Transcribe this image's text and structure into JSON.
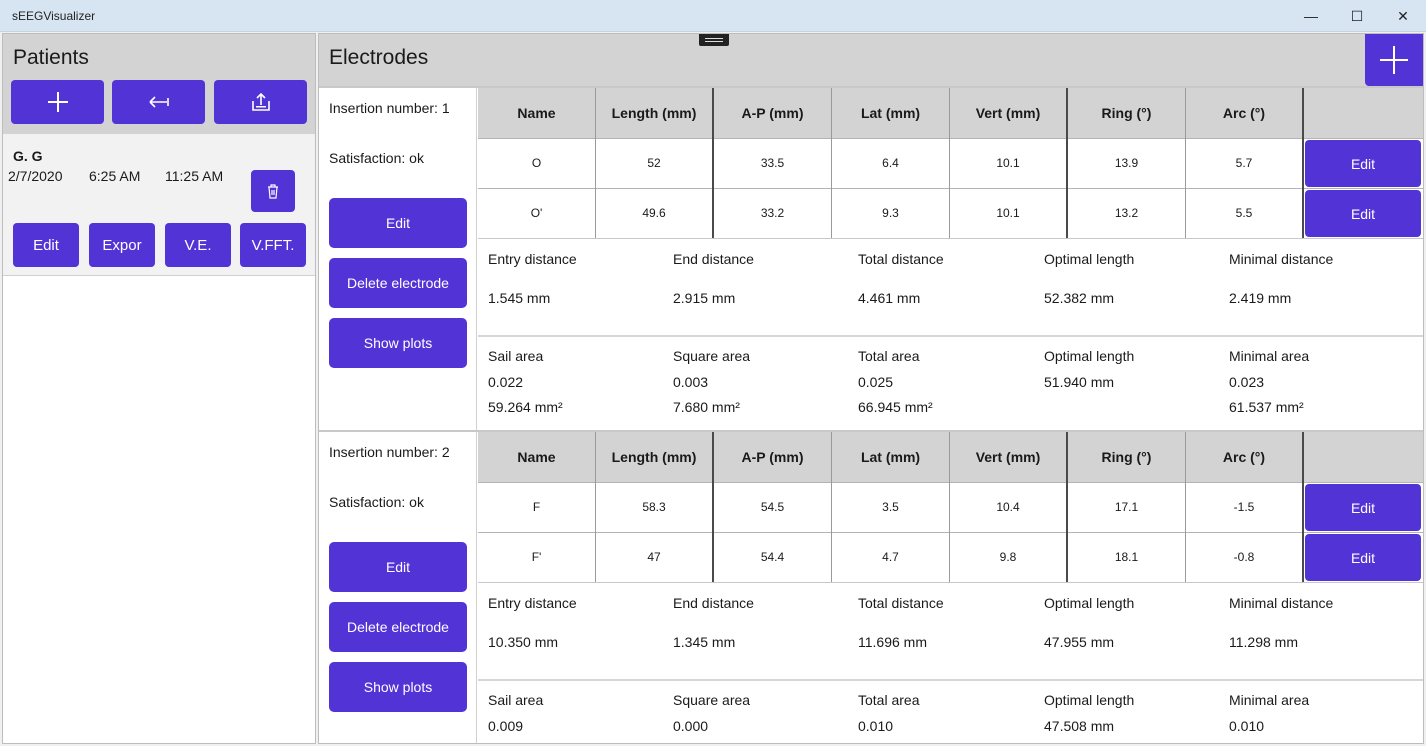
{
  "window": {
    "title": "sEEGVisualizer",
    "min_glyph": "—",
    "max_glyph": "☐",
    "close_glyph": "✕"
  },
  "patients": {
    "title": "Patients",
    "patient": {
      "name": "G. G",
      "date": "2/7/2020",
      "time_start": "6:25 AM",
      "time_end": "11:25 AM",
      "buttons": {
        "edit": "Edit",
        "export": "Expor",
        "ve": "V.E.",
        "vfft": "V.FFT."
      }
    }
  },
  "electrodes": {
    "title": "Electrodes",
    "columns": [
      "Name",
      "Length (mm)",
      "A-P (mm)",
      "Lat (mm)",
      "Vert (mm)",
      "Ring (°)",
      "Arc (°)"
    ],
    "row_button": "Edit",
    "side_buttons": {
      "edit": "Edit",
      "delete": "Delete electrode",
      "plots": "Show plots"
    },
    "insertions": [
      {
        "number_label": "Insertion number: 1",
        "satisfaction_label": "Satisfaction: ok",
        "rows": [
          [
            "O",
            "52",
            "33.5",
            "6.4",
            "10.1",
            "13.9",
            "5.7"
          ],
          [
            "O'",
            "49.6",
            "33.2",
            "9.3",
            "10.1",
            "13.2",
            "5.5"
          ]
        ],
        "distances": {
          "labels": [
            "Entry distance",
            "End distance",
            "Total distance",
            "Optimal length",
            "Minimal distance"
          ],
          "values": [
            "1.545 mm",
            "2.915 mm",
            "4.461 mm",
            "52.382 mm",
            "2.419 mm"
          ]
        },
        "areas": {
          "labels": [
            "Sail area",
            "Square area",
            "Total area",
            "Optimal length",
            "Minimal area"
          ],
          "values": [
            "0.022",
            "0.003",
            "0.025",
            "51.940 mm",
            "0.023"
          ],
          "values2": [
            "59.264 mm²",
            "7.680 mm²",
            "66.945 mm²",
            "",
            "61.537 mm²"
          ]
        }
      },
      {
        "number_label": "Insertion number: 2",
        "satisfaction_label": "Satisfaction: ok",
        "rows": [
          [
            "F",
            "58.3",
            "54.5",
            "3.5",
            "10.4",
            "17.1",
            "-1.5"
          ],
          [
            "F'",
            "47",
            "54.4",
            "4.7",
            "9.8",
            "18.1",
            "-0.8"
          ]
        ],
        "distances": {
          "labels": [
            "Entry distance",
            "End distance",
            "Total distance",
            "Optimal length",
            "Minimal distance"
          ],
          "values": [
            "10.350 mm",
            "1.345 mm",
            "11.696 mm",
            "47.955 mm",
            "11.298 mm"
          ]
        },
        "areas": {
          "labels": [
            "Sail area",
            "Square area",
            "Total area",
            "Optimal length",
            "Minimal area"
          ],
          "values": [
            "0.009",
            "0.000",
            "0.010",
            "47.508 mm",
            "0.010"
          ],
          "values2": [
            "",
            "",
            "",
            "",
            ""
          ]
        }
      }
    ]
  },
  "colors": {
    "accent": "#5233d6",
    "header_gray": "#d3d3d3",
    "titlebar": "#d7e5f2"
  }
}
